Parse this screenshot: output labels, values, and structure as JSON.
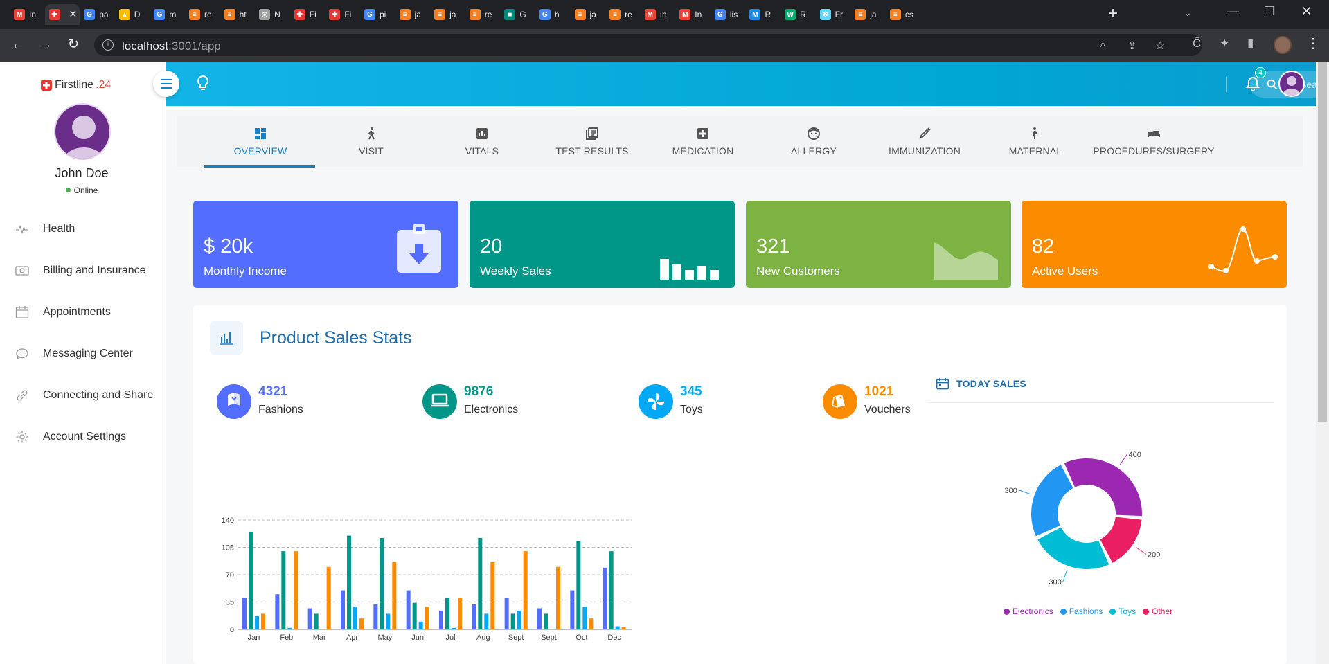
{
  "browser": {
    "tabs": [
      {
        "title": "In",
        "icon": "gmail-icon",
        "color": "#ea4335",
        "glyph": "M"
      },
      {
        "title": "",
        "icon": "firstline-icon",
        "color": "#e53935",
        "glyph": "✚",
        "active": true
      },
      {
        "title": "pa",
        "icon": "google-icon",
        "color": "#4285f4",
        "glyph": "G"
      },
      {
        "title": "D",
        "icon": "drive-icon",
        "color": "#fbbc04",
        "glyph": "▲"
      },
      {
        "title": "m",
        "icon": "google-icon",
        "color": "#4285f4",
        "glyph": "G"
      },
      {
        "title": "re",
        "icon": "stackoverflow-icon",
        "color": "#f48024",
        "glyph": "≡"
      },
      {
        "title": "ht",
        "icon": "stackoverflow-icon",
        "color": "#f48024",
        "glyph": "≡"
      },
      {
        "title": "N",
        "icon": "chrome-icon",
        "color": "#9e9e9e",
        "glyph": "◎"
      },
      {
        "title": "Fi",
        "icon": "firstline-icon",
        "color": "#e53935",
        "glyph": "✚"
      },
      {
        "title": "Fi",
        "icon": "firstline-icon",
        "color": "#e53935",
        "glyph": "✚"
      },
      {
        "title": "pi",
        "icon": "google-icon",
        "color": "#4285f4",
        "glyph": "G"
      },
      {
        "title": "ja",
        "icon": "stackoverflow-icon",
        "color": "#f48024",
        "glyph": "≡"
      },
      {
        "title": "ja",
        "icon": "stackoverflow-icon",
        "color": "#f48024",
        "glyph": "≡"
      },
      {
        "title": "re",
        "icon": "stackoverflow-icon",
        "color": "#f48024",
        "glyph": "≡"
      },
      {
        "title": "G",
        "icon": "meet-icon",
        "color": "#00897b",
        "glyph": "■"
      },
      {
        "title": "h",
        "icon": "google-icon",
        "color": "#4285f4",
        "glyph": "G"
      },
      {
        "title": "ja",
        "icon": "stackoverflow-icon",
        "color": "#f48024",
        "glyph": "≡"
      },
      {
        "title": "re",
        "icon": "stackoverflow-icon",
        "color": "#f48024",
        "glyph": "≡"
      },
      {
        "title": "In",
        "icon": "gmail-icon",
        "color": "#ea4335",
        "glyph": "M"
      },
      {
        "title": "In",
        "icon": "gmail-icon",
        "color": "#ea4335",
        "glyph": "M"
      },
      {
        "title": "lis",
        "icon": "google-icon",
        "color": "#4285f4",
        "glyph": "G"
      },
      {
        "title": "R",
        "icon": "mui-icon",
        "color": "#1e88e5",
        "glyph": "M"
      },
      {
        "title": "R",
        "icon": "w3-icon",
        "color": "#04aa6d",
        "glyph": "W"
      },
      {
        "title": "Fr",
        "icon": "react-icon",
        "color": "#61dafb",
        "glyph": "⚛"
      },
      {
        "title": "ja",
        "icon": "stackoverflow-icon",
        "color": "#f48024",
        "glyph": "≡"
      },
      {
        "title": "cs",
        "icon": "stackoverflow-icon",
        "color": "#f48024",
        "glyph": "≡"
      }
    ],
    "url_host": "localhost",
    "url_rest": ":3001/app"
  },
  "brand": {
    "name": "Firstline",
    "suffix": ".24"
  },
  "user": {
    "name": "John Doe",
    "status": "Online"
  },
  "sidebar": {
    "items": [
      {
        "label": "Health",
        "icon": "pulse-icon"
      },
      {
        "label": "Billing and Insurance",
        "icon": "money-icon"
      },
      {
        "label": "Appointments",
        "icon": "calendar-icon"
      },
      {
        "label": "Messaging Center",
        "icon": "chat-icon"
      },
      {
        "label": "Connecting and Share",
        "icon": "link-icon"
      },
      {
        "label": "Account Settings",
        "icon": "gear-icon"
      }
    ]
  },
  "header": {
    "search_placeholder": "Search UI",
    "notification_count": "4"
  },
  "tabs": [
    {
      "label": "OVERVIEW",
      "icon": "dashboard-icon",
      "active": true
    },
    {
      "label": "VISIT",
      "icon": "walking-icon"
    },
    {
      "label": "VITALS",
      "icon": "bar-chart-icon"
    },
    {
      "label": "TEST RESULTS",
      "icon": "library-icon"
    },
    {
      "label": "MEDICATION",
      "icon": "medical-cross-icon"
    },
    {
      "label": "ALLERGY",
      "icon": "face-icon"
    },
    {
      "label": "IMMUNIZATION",
      "icon": "syringe-icon"
    },
    {
      "label": "MATERNAL",
      "icon": "pregnant-icon"
    },
    {
      "label": "PROCEDURES/SURGERY",
      "icon": "hotel-bed-icon"
    }
  ],
  "cards": [
    {
      "value": "$ 20k",
      "label": "Monthly Income",
      "color": "#536dfe",
      "art": "clipboard-download-icon"
    },
    {
      "value": "20",
      "label": "Weekly Sales",
      "color": "#009688",
      "art": "mini-bars-icon"
    },
    {
      "value": "321",
      "label": "New Customers",
      "color": "#7cb342",
      "art": "mini-area-icon"
    },
    {
      "value": "82",
      "label": "Active Users",
      "color": "#fb8c00",
      "art": "mini-line-icon"
    }
  ],
  "panel": {
    "title": "Product Sales Stats",
    "categories": [
      {
        "value": "4321",
        "label": "Fashions",
        "color": "#536dfe",
        "icon": "book-icon"
      },
      {
        "value": "9876",
        "label": "Electronics",
        "color": "#009688",
        "icon": "laptop-icon"
      },
      {
        "value": "345",
        "label": "Toys",
        "color": "#03a9f4",
        "icon": "pinwheel-icon"
      },
      {
        "value": "1021",
        "label": "Vouchers",
        "color": "#fb8c00",
        "icon": "ticket-icon"
      }
    ],
    "today_label": "TODAY SALES"
  },
  "chart_data": [
    {
      "type": "bar",
      "categories": [
        "Jan",
        "Feb",
        "Mar",
        "Apr",
        "May",
        "Jun",
        "Jul",
        "Aug",
        "Sept",
        "Sept",
        "Oct",
        "Dec"
      ],
      "ylim": [
        0,
        140
      ],
      "yticks": [
        0,
        35,
        70,
        105,
        140
      ],
      "grid": true,
      "series": [
        {
          "color": "#536dfe",
          "values": [
            40,
            45,
            27,
            50,
            32,
            50,
            24,
            32,
            40,
            27,
            50,
            79
          ]
        },
        {
          "color": "#009688",
          "values": [
            125,
            100,
            20,
            120,
            117,
            34,
            40,
            117,
            20,
            20,
            113,
            100
          ]
        },
        {
          "color": "#03a9f4",
          "values": [
            17,
            2,
            0,
            29,
            20,
            10,
            2,
            20,
            24,
            0,
            29,
            4
          ]
        },
        {
          "color": "#fb8c00",
          "values": [
            20,
            100,
            80,
            14,
            86,
            29,
            40,
            86,
            100,
            80,
            14,
            3
          ]
        }
      ]
    },
    {
      "type": "pie",
      "donut": true,
      "labels": [
        "Electronics",
        "Other",
        "Toys",
        "Fashions"
      ],
      "values": [
        400,
        200,
        300,
        300
      ],
      "colors": [
        "#9c27b0",
        "#e91e63",
        "#00bcd4",
        "#2196f3"
      ],
      "legend": [
        "Electronics",
        "Fashions",
        "Toys",
        "Other"
      ],
      "legend_colors": [
        "#9c27b0",
        "#2196f3",
        "#00bcd4",
        "#e91e63"
      ],
      "legend_position": "bottom"
    }
  ]
}
